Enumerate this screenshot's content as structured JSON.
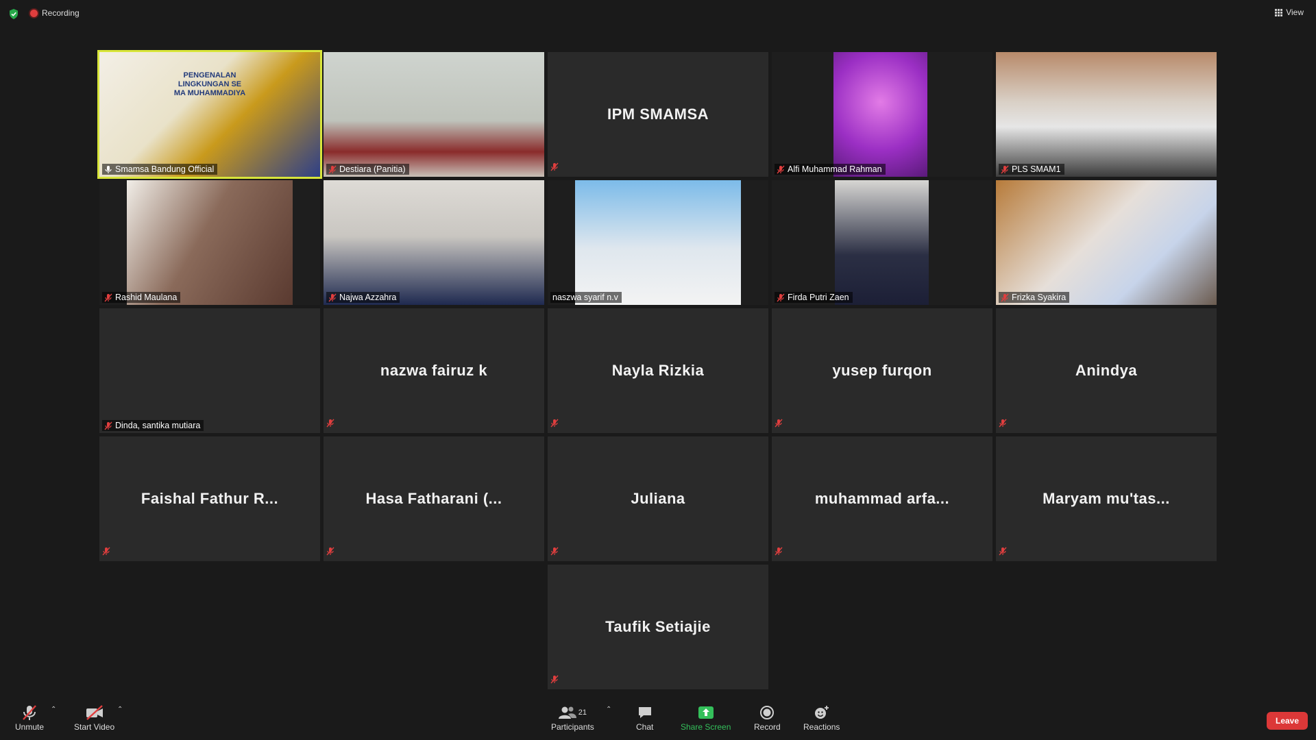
{
  "topbar": {
    "recording_label": "Recording",
    "view_label": "View"
  },
  "participants": [
    {
      "display_name": "Smamsa Bandung Official",
      "video": true,
      "active_speaker": true
    },
    {
      "display_name": "Destiara (Panitia)",
      "video": true
    },
    {
      "display_name": "IPM SMAMSA",
      "video": false
    },
    {
      "display_name": "Alfi Muhammad Rahman",
      "video": true
    },
    {
      "display_name": "PLS SMAM1",
      "video": true
    },
    {
      "display_name": "Rashid Maulana",
      "video": true
    },
    {
      "display_name": "Najwa Azzahra",
      "video": true
    },
    {
      "display_name": "naszwa syarif n.v",
      "video": true
    },
    {
      "display_name": "Firda Putri Zaen",
      "video": true
    },
    {
      "display_name": "Frizka Syakira",
      "video": true
    },
    {
      "display_name": "Dinda, santika mutiara",
      "video": false
    },
    {
      "display_name": "nazwa fairuz k",
      "video": false
    },
    {
      "display_name": "Nayla Rizkia",
      "video": false
    },
    {
      "display_name": "yusep furqon",
      "video": false
    },
    {
      "display_name": "Anindya",
      "video": false
    },
    {
      "display_name": "Faishal Fathur R...",
      "video": false
    },
    {
      "display_name": "Hasa Fatharani (...",
      "video": false
    },
    {
      "display_name": "Juliana",
      "video": false
    },
    {
      "display_name": "muhammad arfa...",
      "video": false
    },
    {
      "display_name": "Maryam mu'tas...",
      "video": false
    },
    {
      "display_name": "Taufik Setiajie",
      "video": false
    }
  ],
  "video_text": {
    "banner_line1": "PENGENALAN",
    "banner_line2": "LINGKUNGAN SE",
    "banner_line3": "MA MUHAMMADIYA"
  },
  "toolbar": {
    "unmute_label": "Unmute",
    "start_video_label": "Start Video",
    "participants_label": "Participants",
    "participants_count": "21",
    "chat_label": "Chat",
    "share_screen_label": "Share Screen",
    "record_label": "Record",
    "reactions_label": "Reactions",
    "leave_label": "Leave"
  },
  "colors": {
    "background": "#1a1a1a",
    "tile": "#2a2a2a",
    "active_speaker_border": "#d8e53a",
    "muted_red": "#e03e3e",
    "share_green": "#34c05b",
    "leave_red": "#dc3838"
  },
  "icons": [
    "shield-icon",
    "recording-dot-icon",
    "view-grid-icon",
    "mic-muted-icon",
    "video-off-icon",
    "participants-icon",
    "chat-icon",
    "share-screen-icon",
    "record-icon",
    "reactions-icon",
    "caret-up-icon"
  ]
}
